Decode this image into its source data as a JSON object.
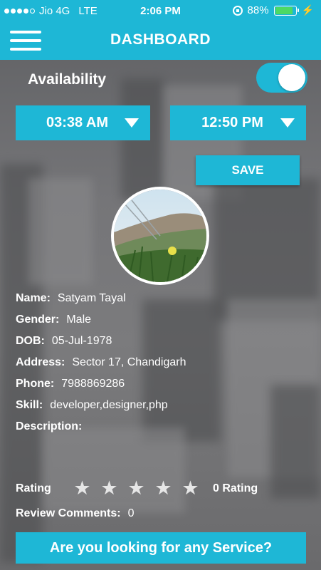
{
  "status_bar": {
    "carrier": "Jio 4G",
    "network": "LTE",
    "time": "2:06 PM",
    "battery": "88%",
    "battery_level": 0.88
  },
  "header": {
    "title": "DASHBOARD"
  },
  "availability": {
    "label": "Availability",
    "enabled": true
  },
  "time_range": {
    "start": "03:38 AM",
    "end": "12:50 PM"
  },
  "save_label": "SAVE",
  "profile": {
    "fields": [
      {
        "key": "Name:",
        "value": "Satyam Tayal"
      },
      {
        "key": "Gender:",
        "value": "Male"
      },
      {
        "key": "DOB:",
        "value": "05-Jul-1978"
      },
      {
        "key": "Address:",
        "value": "Sector 17, Chandigarh"
      },
      {
        "key": "Phone:",
        "value": "7988869286"
      },
      {
        "key": "Skill:",
        "value": "developer,designer,php"
      },
      {
        "key": "Description:",
        "value": ""
      }
    ]
  },
  "rating": {
    "label": "Rating",
    "stars_filled": 0,
    "stars_total": 5,
    "summary": "0 Rating"
  },
  "review": {
    "label": "Review Comments:",
    "value": "0"
  },
  "service_button": "Are you looking for any Service?",
  "colors": {
    "accent": "#1eb7d6",
    "text": "#ffffff",
    "battery": "#4cd964"
  }
}
